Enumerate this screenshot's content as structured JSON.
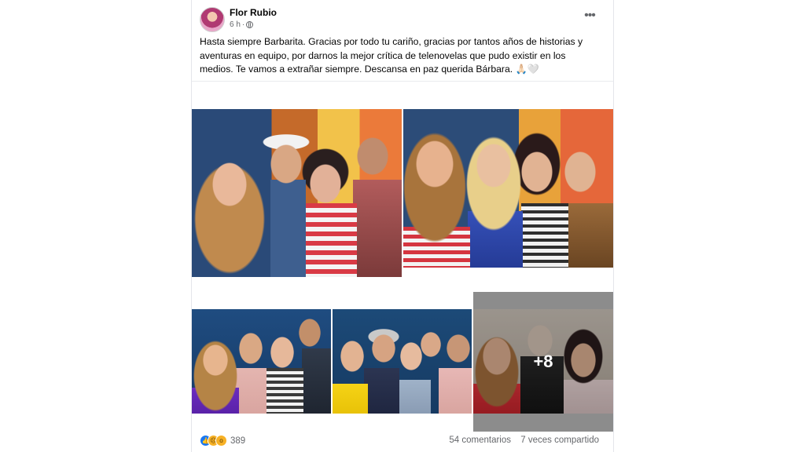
{
  "post": {
    "author": "Flor Rubio",
    "time": "6 h",
    "privacy_icon": "globe-icon",
    "more_icon": "ellipsis-icon",
    "text": "Hasta siempre Barbarita. Gracias por todo tu cariño, gracias por tantos años de historias y aventuras en equipo, por darnos la mejor crítica de telenovelas que pudo existir en los medios. Te vamos a extrañar siempre. Descansa en paz querida Bárbara. 🙏🏻🤍"
  },
  "gallery": {
    "extra_count": "+8"
  },
  "footer": {
    "reactions": [
      "like-icon",
      "sad-icon",
      "wow-icon"
    ],
    "reaction_count": "389",
    "comments": "54 comentarios",
    "shares": "7 veces compartido"
  },
  "colors": {
    "link_blue": "#1877f2",
    "secondary_text": "#65676b",
    "divider": "#e9ebee"
  }
}
